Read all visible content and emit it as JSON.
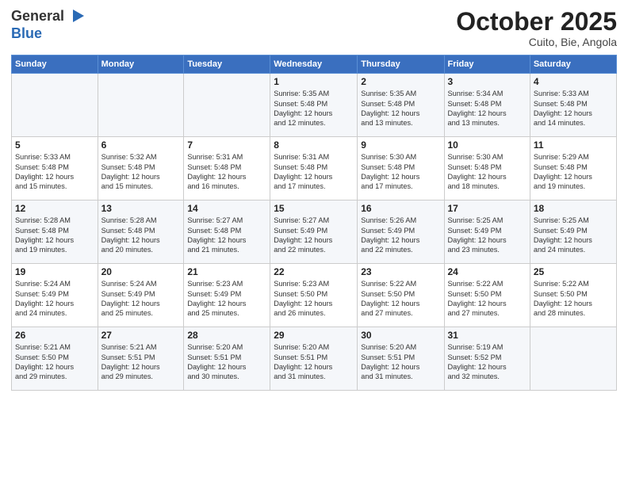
{
  "header": {
    "logo_line1": "General",
    "logo_line2": "Blue",
    "month": "October 2025",
    "location": "Cuito, Bie, Angola"
  },
  "weekdays": [
    "Sunday",
    "Monday",
    "Tuesday",
    "Wednesday",
    "Thursday",
    "Friday",
    "Saturday"
  ],
  "weeks": [
    [
      {
        "day": "",
        "info": ""
      },
      {
        "day": "",
        "info": ""
      },
      {
        "day": "",
        "info": ""
      },
      {
        "day": "1",
        "info": "Sunrise: 5:35 AM\nSunset: 5:48 PM\nDaylight: 12 hours\nand 12 minutes."
      },
      {
        "day": "2",
        "info": "Sunrise: 5:35 AM\nSunset: 5:48 PM\nDaylight: 12 hours\nand 13 minutes."
      },
      {
        "day": "3",
        "info": "Sunrise: 5:34 AM\nSunset: 5:48 PM\nDaylight: 12 hours\nand 13 minutes."
      },
      {
        "day": "4",
        "info": "Sunrise: 5:33 AM\nSunset: 5:48 PM\nDaylight: 12 hours\nand 14 minutes."
      }
    ],
    [
      {
        "day": "5",
        "info": "Sunrise: 5:33 AM\nSunset: 5:48 PM\nDaylight: 12 hours\nand 15 minutes."
      },
      {
        "day": "6",
        "info": "Sunrise: 5:32 AM\nSunset: 5:48 PM\nDaylight: 12 hours\nand 15 minutes."
      },
      {
        "day": "7",
        "info": "Sunrise: 5:31 AM\nSunset: 5:48 PM\nDaylight: 12 hours\nand 16 minutes."
      },
      {
        "day": "8",
        "info": "Sunrise: 5:31 AM\nSunset: 5:48 PM\nDaylight: 12 hours\nand 17 minutes."
      },
      {
        "day": "9",
        "info": "Sunrise: 5:30 AM\nSunset: 5:48 PM\nDaylight: 12 hours\nand 17 minutes."
      },
      {
        "day": "10",
        "info": "Sunrise: 5:30 AM\nSunset: 5:48 PM\nDaylight: 12 hours\nand 18 minutes."
      },
      {
        "day": "11",
        "info": "Sunrise: 5:29 AM\nSunset: 5:48 PM\nDaylight: 12 hours\nand 19 minutes."
      }
    ],
    [
      {
        "day": "12",
        "info": "Sunrise: 5:28 AM\nSunset: 5:48 PM\nDaylight: 12 hours\nand 19 minutes."
      },
      {
        "day": "13",
        "info": "Sunrise: 5:28 AM\nSunset: 5:48 PM\nDaylight: 12 hours\nand 20 minutes."
      },
      {
        "day": "14",
        "info": "Sunrise: 5:27 AM\nSunset: 5:48 PM\nDaylight: 12 hours\nand 21 minutes."
      },
      {
        "day": "15",
        "info": "Sunrise: 5:27 AM\nSunset: 5:49 PM\nDaylight: 12 hours\nand 22 minutes."
      },
      {
        "day": "16",
        "info": "Sunrise: 5:26 AM\nSunset: 5:49 PM\nDaylight: 12 hours\nand 22 minutes."
      },
      {
        "day": "17",
        "info": "Sunrise: 5:25 AM\nSunset: 5:49 PM\nDaylight: 12 hours\nand 23 minutes."
      },
      {
        "day": "18",
        "info": "Sunrise: 5:25 AM\nSunset: 5:49 PM\nDaylight: 12 hours\nand 24 minutes."
      }
    ],
    [
      {
        "day": "19",
        "info": "Sunrise: 5:24 AM\nSunset: 5:49 PM\nDaylight: 12 hours\nand 24 minutes."
      },
      {
        "day": "20",
        "info": "Sunrise: 5:24 AM\nSunset: 5:49 PM\nDaylight: 12 hours\nand 25 minutes."
      },
      {
        "day": "21",
        "info": "Sunrise: 5:23 AM\nSunset: 5:49 PM\nDaylight: 12 hours\nand 25 minutes."
      },
      {
        "day": "22",
        "info": "Sunrise: 5:23 AM\nSunset: 5:50 PM\nDaylight: 12 hours\nand 26 minutes."
      },
      {
        "day": "23",
        "info": "Sunrise: 5:22 AM\nSunset: 5:50 PM\nDaylight: 12 hours\nand 27 minutes."
      },
      {
        "day": "24",
        "info": "Sunrise: 5:22 AM\nSunset: 5:50 PM\nDaylight: 12 hours\nand 27 minutes."
      },
      {
        "day": "25",
        "info": "Sunrise: 5:22 AM\nSunset: 5:50 PM\nDaylight: 12 hours\nand 28 minutes."
      }
    ],
    [
      {
        "day": "26",
        "info": "Sunrise: 5:21 AM\nSunset: 5:50 PM\nDaylight: 12 hours\nand 29 minutes."
      },
      {
        "day": "27",
        "info": "Sunrise: 5:21 AM\nSunset: 5:51 PM\nDaylight: 12 hours\nand 29 minutes."
      },
      {
        "day": "28",
        "info": "Sunrise: 5:20 AM\nSunset: 5:51 PM\nDaylight: 12 hours\nand 30 minutes."
      },
      {
        "day": "29",
        "info": "Sunrise: 5:20 AM\nSunset: 5:51 PM\nDaylight: 12 hours\nand 31 minutes."
      },
      {
        "day": "30",
        "info": "Sunrise: 5:20 AM\nSunset: 5:51 PM\nDaylight: 12 hours\nand 31 minutes."
      },
      {
        "day": "31",
        "info": "Sunrise: 5:19 AM\nSunset: 5:52 PM\nDaylight: 12 hours\nand 32 minutes."
      },
      {
        "day": "",
        "info": ""
      }
    ]
  ]
}
